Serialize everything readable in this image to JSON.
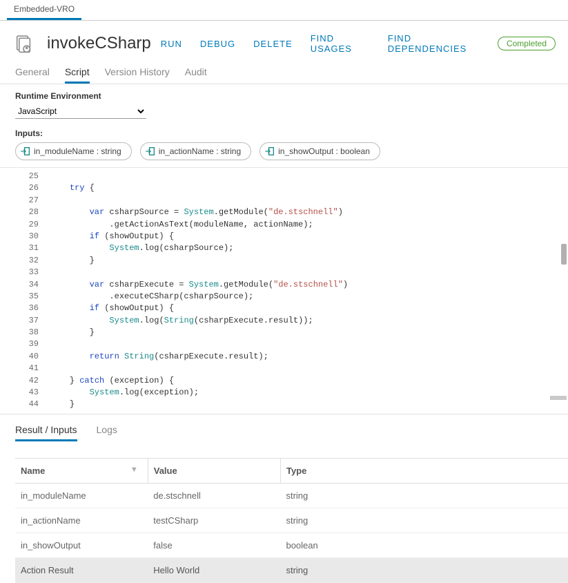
{
  "topTab": "Embedded-VRO",
  "title": "invokeCSharp",
  "actions": {
    "run": "RUN",
    "debug": "DEBUG",
    "delete": "DELETE",
    "findUsages": "FIND USAGES",
    "findDeps": "FIND DEPENDENCIES"
  },
  "status": "Completed",
  "subTabs": {
    "general": "General",
    "script": "Script",
    "version": "Version History",
    "audit": "Audit"
  },
  "runtimeLabel": "Runtime Environment",
  "runtimeValue": "JavaScript",
  "inputsLabel": "Inputs:",
  "inputChips": [
    "in_moduleName : string",
    "in_actionName : string",
    "in_showOutput : boolean"
  ],
  "code": {
    "start": 25,
    "lines": [
      "",
      "    try {",
      "",
      "        var csharpSource = System.getModule(\"de.stschnell\")",
      "            .getActionAsText(moduleName, actionName);",
      "        if (showOutput) {",
      "            System.log(csharpSource);",
      "        }",
      "",
      "        var csharpExecute = System.getModule(\"de.stschnell\")",
      "            .executeCSharp(csharpSource);",
      "        if (showOutput) {",
      "            System.log(String(csharpExecute.result));",
      "        }",
      "",
      "        return String(csharpExecute.result);",
      "",
      "    } catch (exception) {",
      "        System.log(exception);",
      "    }"
    ]
  },
  "bottomTabs": {
    "result": "Result / Inputs",
    "logs": "Logs"
  },
  "table": {
    "headers": {
      "name": "Name",
      "value": "Value",
      "type": "Type"
    },
    "rows": [
      {
        "name": "in_moduleName",
        "value": "de.stschnell",
        "type": "string",
        "hl": false
      },
      {
        "name": "in_actionName",
        "value": "testCSharp",
        "type": "string",
        "hl": false
      },
      {
        "name": "in_showOutput",
        "value": "false",
        "type": "boolean",
        "hl": false
      },
      {
        "name": "Action Result",
        "value": "Hello World",
        "type": "string",
        "hl": true
      }
    ]
  }
}
